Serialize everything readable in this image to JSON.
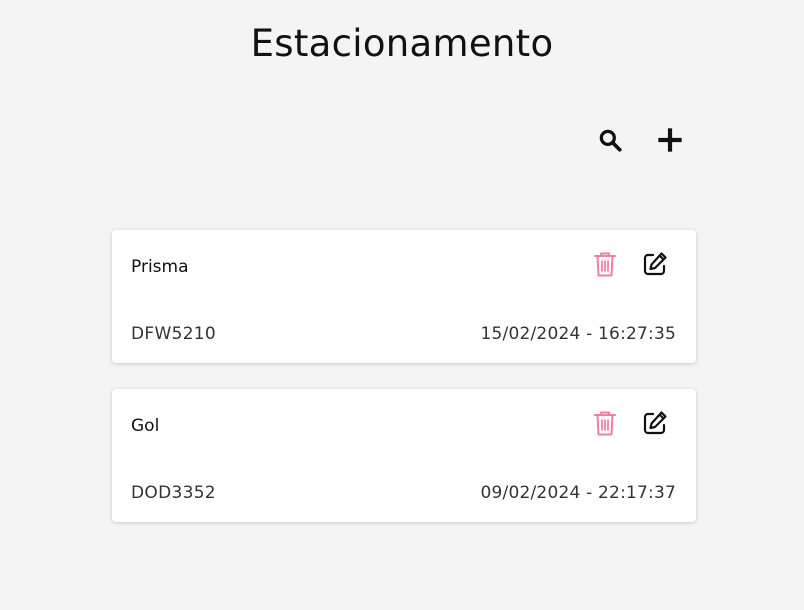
{
  "page": {
    "title": "Estacionamento"
  },
  "toolbar": {
    "search_icon": "search-icon",
    "add_icon": "plus-icon"
  },
  "vehicles": [
    {
      "name": "Prisma",
      "plate": "DFW5210",
      "datetime": "15/02/2024 - 16:27:35",
      "delete_icon": "trash-icon",
      "edit_icon": "edit-icon"
    },
    {
      "name": "Gol",
      "plate": "DOD3352",
      "datetime": "09/02/2024 - 22:17:37",
      "delete_icon": "trash-icon",
      "edit_icon": "edit-icon"
    }
  ],
  "colors": {
    "background": "#f4f4f4",
    "card": "#ffffff",
    "delete": "#f07fa0",
    "icon": "#111111"
  }
}
